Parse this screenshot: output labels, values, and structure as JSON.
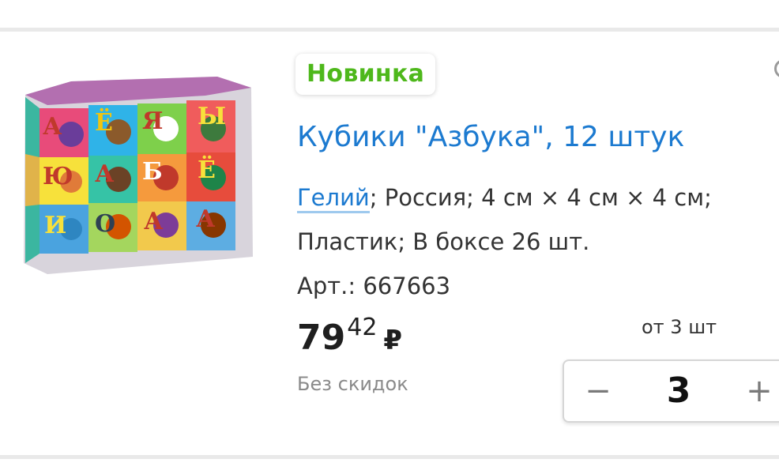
{
  "product": {
    "badge": "Новинка",
    "title": "Кубики \"Азбука\", 12 штук",
    "brand": "Гелий",
    "specs_rest": "; Россия; 4 см × 4 см × 4 см; Пластик; В боксе 26 шт.",
    "article": "Арт.: 667663",
    "price_int": "79",
    "price_kop": "42",
    "currency": "₽",
    "discount_note": "Без скидок",
    "min_qty_label": "от 3 шт",
    "quantity": "3",
    "image_letters": [
      "А",
      "Ё",
      "Я",
      "Ы",
      "Ю",
      "А",
      "Б",
      "Ё",
      "И",
      "О",
      "А",
      "А"
    ]
  },
  "stepper": {
    "minus": "−",
    "plus": "+"
  },
  "colors": {
    "badge_green": "#4eb81b",
    "link_blue": "#1c7ad0"
  }
}
